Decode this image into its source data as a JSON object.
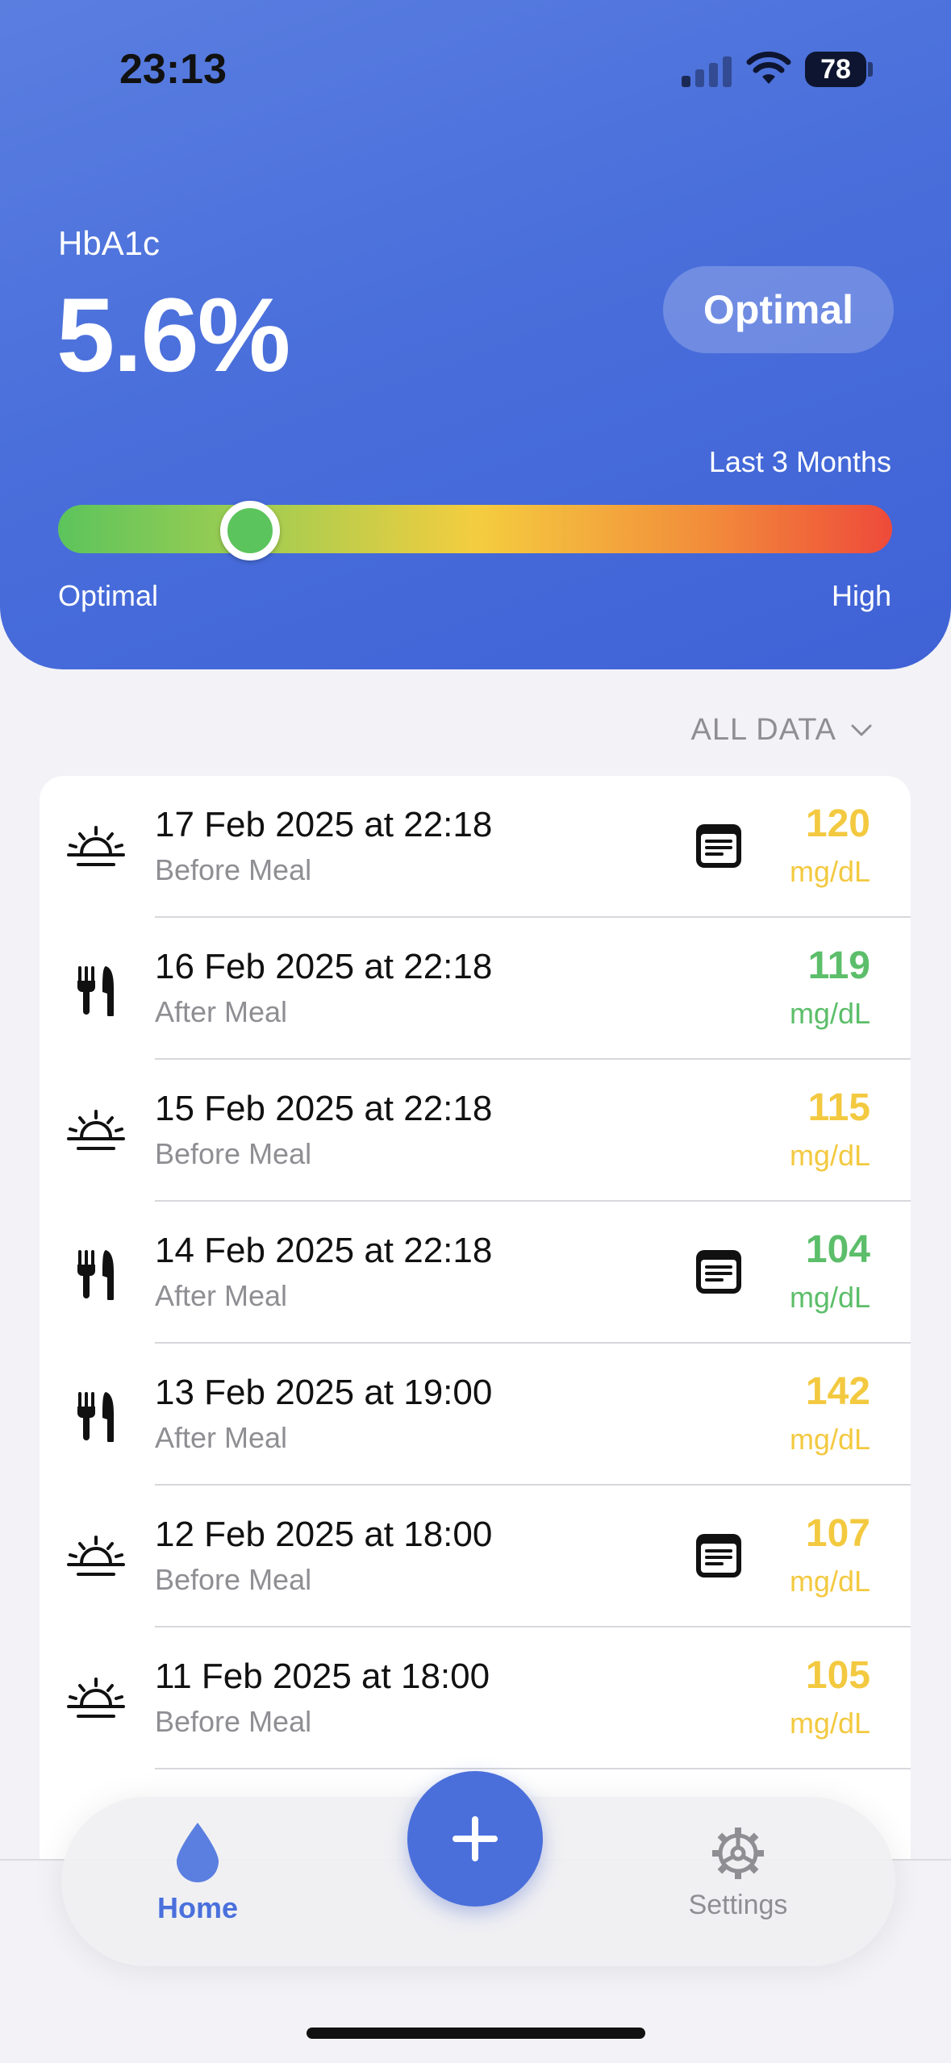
{
  "status_bar": {
    "time": "23:13",
    "battery": "78"
  },
  "summary": {
    "metric_label": "HbA1c",
    "metric_value": "5.6%",
    "status": "Optimal",
    "period": "Last 3 Months",
    "gauge_position": 0.23,
    "gauge_min_label": "Optimal",
    "gauge_max_label": "High",
    "gauge_colors": [
      "#5cc45c",
      "#f4cd3f",
      "#ee4a3a"
    ]
  },
  "filter": {
    "label": "ALL DATA"
  },
  "colors": {
    "accent": "#4a6fdb",
    "in_range": "#5cbe6a",
    "elevated": "#f3c940"
  },
  "readings": [
    {
      "icon": "sunrise-icon",
      "date": "17 Feb 2025 at 22:18",
      "meal": "Before Meal",
      "value": "120",
      "unit": "mg/dL",
      "status": "elevated",
      "has_note": true
    },
    {
      "icon": "fork-knife-icon",
      "date": "16 Feb 2025 at 22:18",
      "meal": "After Meal",
      "value": "119",
      "unit": "mg/dL",
      "status": "in_range",
      "has_note": false
    },
    {
      "icon": "sunrise-icon",
      "date": "15 Feb 2025 at 22:18",
      "meal": "Before Meal",
      "value": "115",
      "unit": "mg/dL",
      "status": "elevated",
      "has_note": false
    },
    {
      "icon": "fork-knife-icon",
      "date": "14 Feb 2025 at 22:18",
      "meal": "After Meal",
      "value": "104",
      "unit": "mg/dL",
      "status": "in_range",
      "has_note": true
    },
    {
      "icon": "fork-knife-icon",
      "date": "13 Feb 2025 at 19:00",
      "meal": "After Meal",
      "value": "142",
      "unit": "mg/dL",
      "status": "elevated",
      "has_note": false
    },
    {
      "icon": "sunrise-icon",
      "date": "12 Feb 2025 at 18:00",
      "meal": "Before Meal",
      "value": "107",
      "unit": "mg/dL",
      "status": "elevated",
      "has_note": true
    },
    {
      "icon": "sunrise-icon",
      "date": "11 Feb 2025 at 18:00",
      "meal": "Before Meal",
      "value": "105",
      "unit": "mg/dL",
      "status": "elevated",
      "has_note": false
    }
  ],
  "tabs": {
    "home": "Home",
    "settings": "Settings"
  }
}
